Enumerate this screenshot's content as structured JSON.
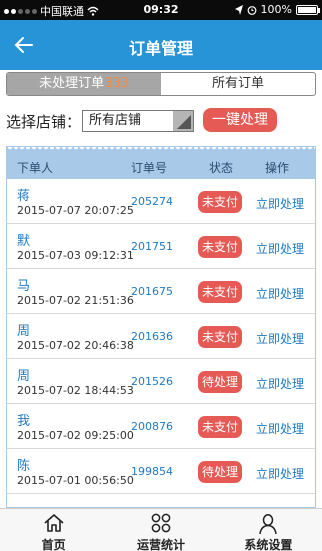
{
  "status_bar": {
    "carrier": "中国联通",
    "time": "09:32",
    "battery": "100%"
  },
  "header": {
    "title": "订单管理"
  },
  "tabs": {
    "pending_label": "未处理订单",
    "pending_count": "333",
    "all_label": "所有订单"
  },
  "filter": {
    "store_label": "选择店铺：",
    "store_value": "所有店铺",
    "process_all_label": "一键处理"
  },
  "table": {
    "headers": {
      "user": "下单人",
      "order_no": "订单号",
      "status": "状态",
      "action": "操作"
    },
    "rows": [
      {
        "name": "蒋",
        "date": "2015-07-07 20:07:25",
        "order_no": "205274",
        "status": "未支付",
        "action": "立即处理"
      },
      {
        "name": "默",
        "date": "2015-07-03 09:12:31",
        "order_no": "201751",
        "status": "未支付",
        "action": "立即处理"
      },
      {
        "name": "马",
        "date": "2015-07-02 21:51:36",
        "order_no": "201675",
        "status": "未支付",
        "action": "立即处理"
      },
      {
        "name": "周",
        "date": "2015-07-02 20:46:38",
        "order_no": "201636",
        "status": "未支付",
        "action": "立即处理"
      },
      {
        "name": "周",
        "date": "2015-07-02 18:44:53",
        "order_no": "201526",
        "status": "待处理",
        "action": "立即处理"
      },
      {
        "name": "我",
        "date": "2015-07-02 09:25:00",
        "order_no": "200876",
        "status": "未支付",
        "action": "立即处理"
      },
      {
        "name": "陈",
        "date": "2015-07-01 00:56:50",
        "order_no": "199854",
        "status": "待处理",
        "action": "立即处理"
      }
    ]
  },
  "tabbar": {
    "items": [
      {
        "label": "首页",
        "icon": "home-icon"
      },
      {
        "label": "运营统计",
        "icon": "grid-circles-icon"
      },
      {
        "label": "系统设置",
        "icon": "person-icon"
      }
    ]
  },
  "colors": {
    "brand": "#2894d8",
    "status_red": "#e65a55",
    "link_blue": "#1f7ac3",
    "count_orange": "#f38b45"
  }
}
